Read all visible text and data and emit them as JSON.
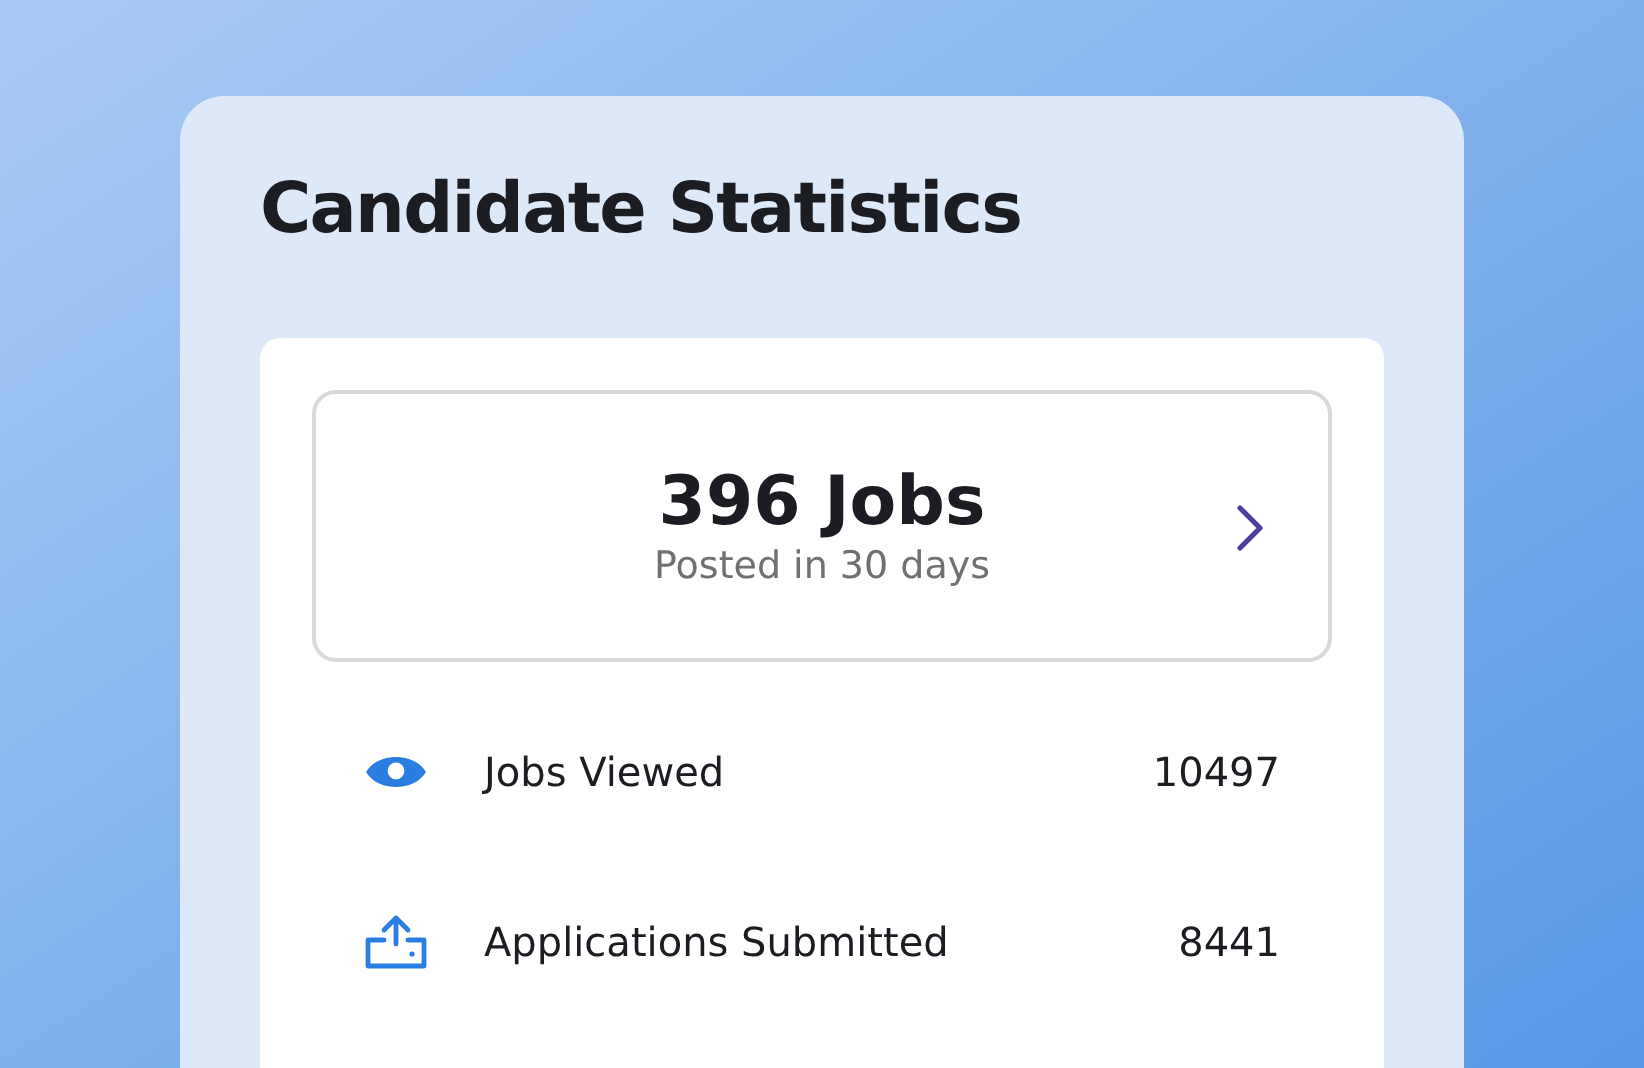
{
  "title": "Candidate Statistics",
  "summary": {
    "headline": "396 Jobs",
    "caption": "Posted in 30 days"
  },
  "stats": [
    {
      "kind": "eye",
      "label": "Jobs Viewed",
      "value": "10497"
    },
    {
      "kind": "upload",
      "label": "Applications Submitted",
      "value": "8441"
    }
  ]
}
